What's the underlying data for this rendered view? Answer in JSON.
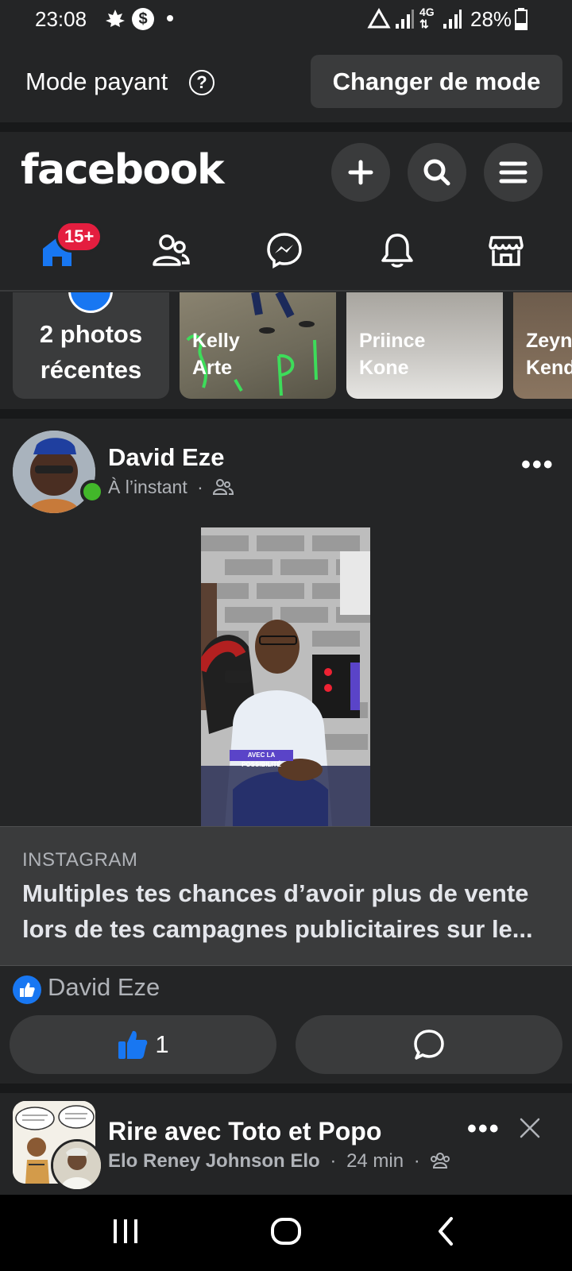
{
  "status_bar": {
    "time": "23:08",
    "battery": "28%"
  },
  "mode_bar": {
    "label": "Mode payant",
    "help_glyph": "?",
    "button": "Changer de mode"
  },
  "header": {
    "logo": "facebook"
  },
  "nav": {
    "notifications_badge": "15+"
  },
  "stories": {
    "own": {
      "line1": "2 photos",
      "line2": "récentes"
    },
    "items": [
      {
        "first": "Kelly",
        "last": "Arte"
      },
      {
        "first": "Priince",
        "last": "Kone"
      },
      {
        "first": "Zeyna",
        "last": "Kend"
      }
    ]
  },
  "post": {
    "author": "David Eze",
    "time": "À l’instant",
    "separator": "·",
    "link": {
      "source": "INSTAGRAM",
      "title": "Multiples tes chances d’avoir plus de vente lors de tes campagnes publicitaires sur le..."
    },
    "video_caption": "AVEC LA POSSIBILITÉ",
    "reactor": "David Eze",
    "like_count": "1"
  },
  "next_post": {
    "group": "Rire avec Toto et Popo",
    "author": "Elo Reney Johnson Elo",
    "time": "24 min",
    "separator": "·"
  },
  "colors": {
    "background": "#242526",
    "separator": "#18191a",
    "button": "#3a3b3c",
    "accent_blue": "#1877f2",
    "badge_red": "#e41e3f",
    "online_green": "#42b72a"
  }
}
